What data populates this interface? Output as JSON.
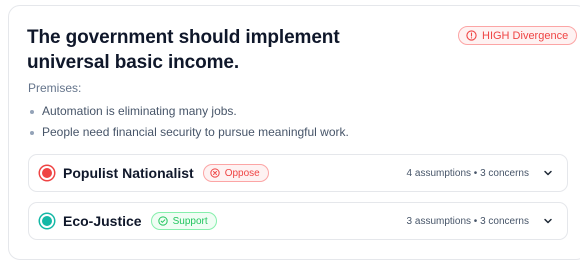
{
  "statement": {
    "title": "The government should implement universal basic income.",
    "divergence_badge": "HIGH Divergence",
    "divergence_color": "#ef4444"
  },
  "premises": {
    "label": "Premises:",
    "items": [
      "Automation is eliminating many jobs.",
      "People need financial security to pursue meaningful work."
    ]
  },
  "perspectives": [
    {
      "name": "Populist Nationalist",
      "color": "#ef4444",
      "stance": "Oppose",
      "stance_icon": "x-circle-icon",
      "meta": "4 assumptions • 3 concerns"
    },
    {
      "name": "Eco-Justice",
      "color": "#14b8a6",
      "stance": "Support",
      "stance_icon": "check-circle-icon",
      "meta": "3 assumptions • 3 concerns"
    }
  ]
}
